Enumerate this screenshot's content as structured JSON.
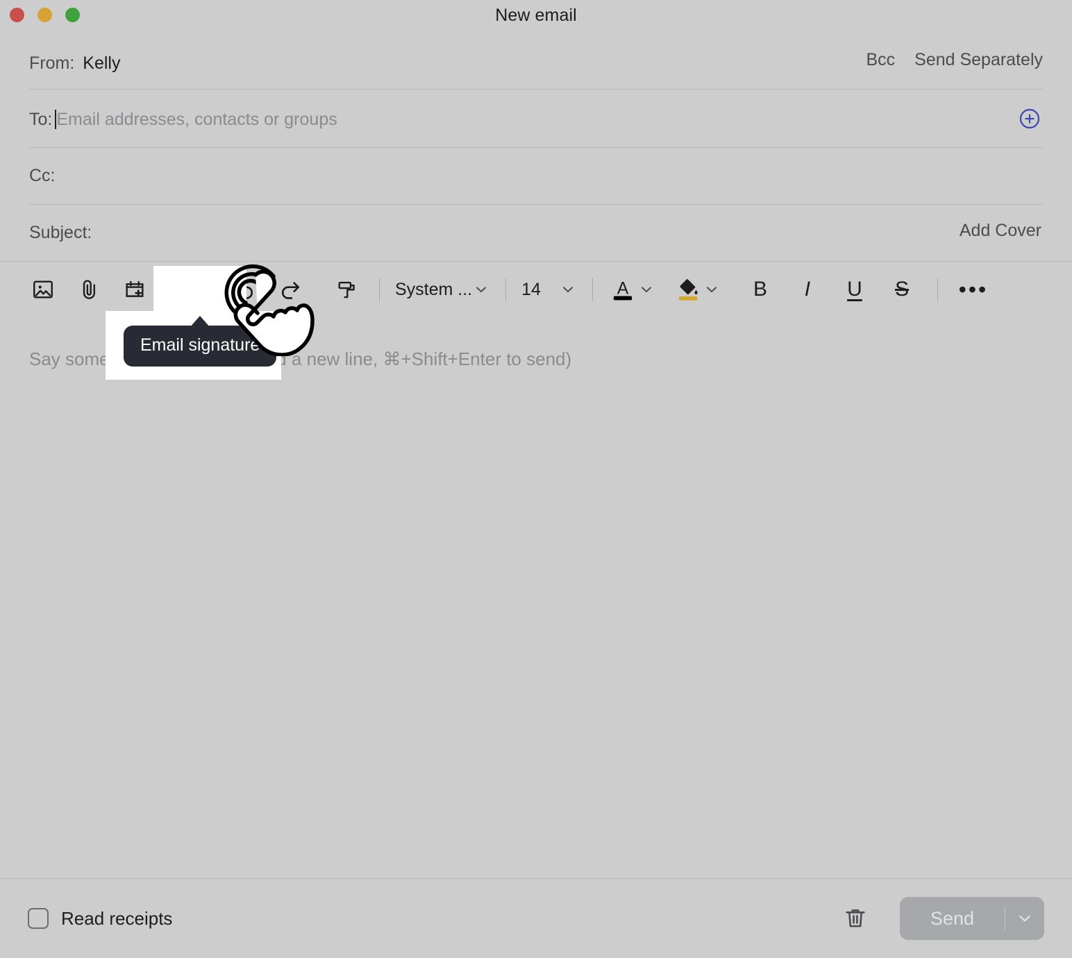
{
  "window": {
    "title": "New email",
    "traffic_lights": [
      {
        "name": "close",
        "color": "#c9504a"
      },
      {
        "name": "minimize",
        "color": "#d6a233"
      },
      {
        "name": "maximize",
        "color": "#3ea23c"
      }
    ]
  },
  "header": {
    "from_label": "From:",
    "from_value": "Kelly",
    "bcc_label": "Bcc",
    "send_separately_label": "Send Separately",
    "to_label": "To:",
    "to_placeholder": "Email addresses, contacts or groups",
    "add_recipient_icon": "plus-circle-icon",
    "cc_label": "Cc:",
    "cc_value": "",
    "subject_label": "Subject:",
    "subject_value": "",
    "add_cover_label": "Add Cover"
  },
  "toolbar": {
    "items": [
      {
        "name": "insert-image",
        "icon": "image-icon"
      },
      {
        "name": "attach-file",
        "icon": "paperclip-icon"
      },
      {
        "name": "insert-event",
        "icon": "calendar-add-icon"
      },
      {
        "name": "email-signature",
        "icon": "signature-pen-icon",
        "has_chevron": true,
        "hovered": true
      },
      {
        "name": "undo",
        "icon": "undo-arrow-icon"
      },
      {
        "name": "redo",
        "icon": "redo-arrow-icon"
      },
      {
        "name": "format-painter",
        "icon": "paint-roller-icon"
      }
    ],
    "font_family_value": "System ...",
    "font_size_value": "14",
    "text_color": {
      "name": "text-color",
      "icon": "letter-a-icon",
      "swatch": "#000000"
    },
    "highlight_color": {
      "name": "highlight-color",
      "icon": "paint-bucket-icon",
      "swatch": "#d4a92b"
    },
    "bold_label": "B",
    "italic_label": "I",
    "underline_label": "U",
    "strikethrough_label": "S",
    "more_label": "•••"
  },
  "body": {
    "placeholder": "Say something (⌘+Enter to add a new line, ⌘+Shift+Enter to send)"
  },
  "tooltip": {
    "text": "Email signature"
  },
  "footer": {
    "read_receipts_label": "Read receipts",
    "read_receipts_checked": false,
    "discard_icon": "trash-icon",
    "send_label": "Send",
    "send_dropdown_icon": "chevron-down-icon",
    "send_enabled": false
  },
  "colors": {
    "window_background": "#cdcdcd",
    "divider": "#b6b6b6",
    "accent_blue": "#3b49b5",
    "tooltip_background": "#282b33",
    "highlight_box": "#ffffff"
  }
}
